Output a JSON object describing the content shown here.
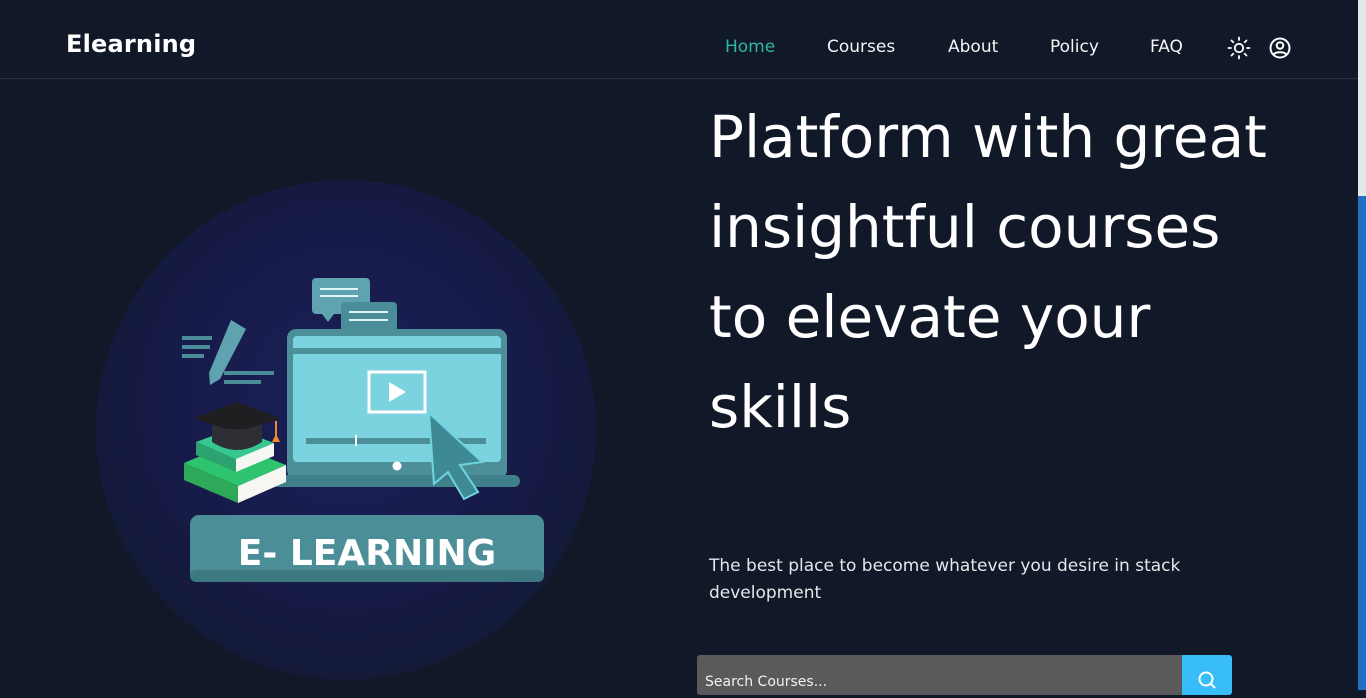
{
  "brand": "Elearning",
  "nav": {
    "items": [
      {
        "label": "Home",
        "active": true
      },
      {
        "label": "Courses"
      },
      {
        "label": "About"
      },
      {
        "label": "Policy"
      },
      {
        "label": "FAQ"
      }
    ],
    "icons": [
      "sun-icon",
      "user-circle-icon"
    ]
  },
  "hero": {
    "title": "Platform with great insightful courses to elevate your skills",
    "subtitle": "The best place to become whatever you desire in stack development",
    "image_banner": "E- LEARNING"
  },
  "search": {
    "placeholder": "Search Courses..."
  },
  "colors": {
    "background": "#111827",
    "accent": "#2fb6a7",
    "search_button": "#38bdf8",
    "scroll_thumb": "#1e70c4"
  }
}
